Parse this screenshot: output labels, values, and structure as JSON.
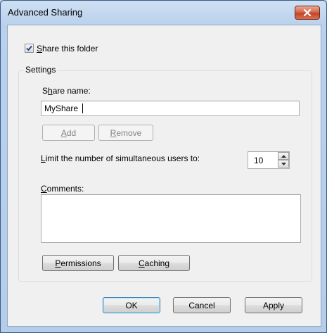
{
  "window": {
    "title": "Advanced Sharing"
  },
  "share_checkbox": {
    "checked": true,
    "label_first": "S",
    "label_rest": "hare this folder"
  },
  "settings": {
    "group_label": "Settings",
    "share_name_label_pre": "S",
    "share_name_label_u": "h",
    "share_name_label_post": "are name:",
    "share_name_value": "MyShare",
    "add_button": {
      "u": "A",
      "rest": "dd"
    },
    "remove_button": {
      "u": "R",
      "rest": "emove"
    },
    "limit_label_u": "L",
    "limit_label_rest": "imit the number of simultaneous users to:",
    "limit_value": "10",
    "comments_label_u": "C",
    "comments_label_rest": "omments:",
    "comments_value": "",
    "permissions_button": {
      "u": "P",
      "rest": "ermissions"
    },
    "caching_button": {
      "u": "C",
      "rest": "aching"
    }
  },
  "footer": {
    "ok": "OK",
    "cancel": "Cancel",
    "apply": "Apply"
  }
}
